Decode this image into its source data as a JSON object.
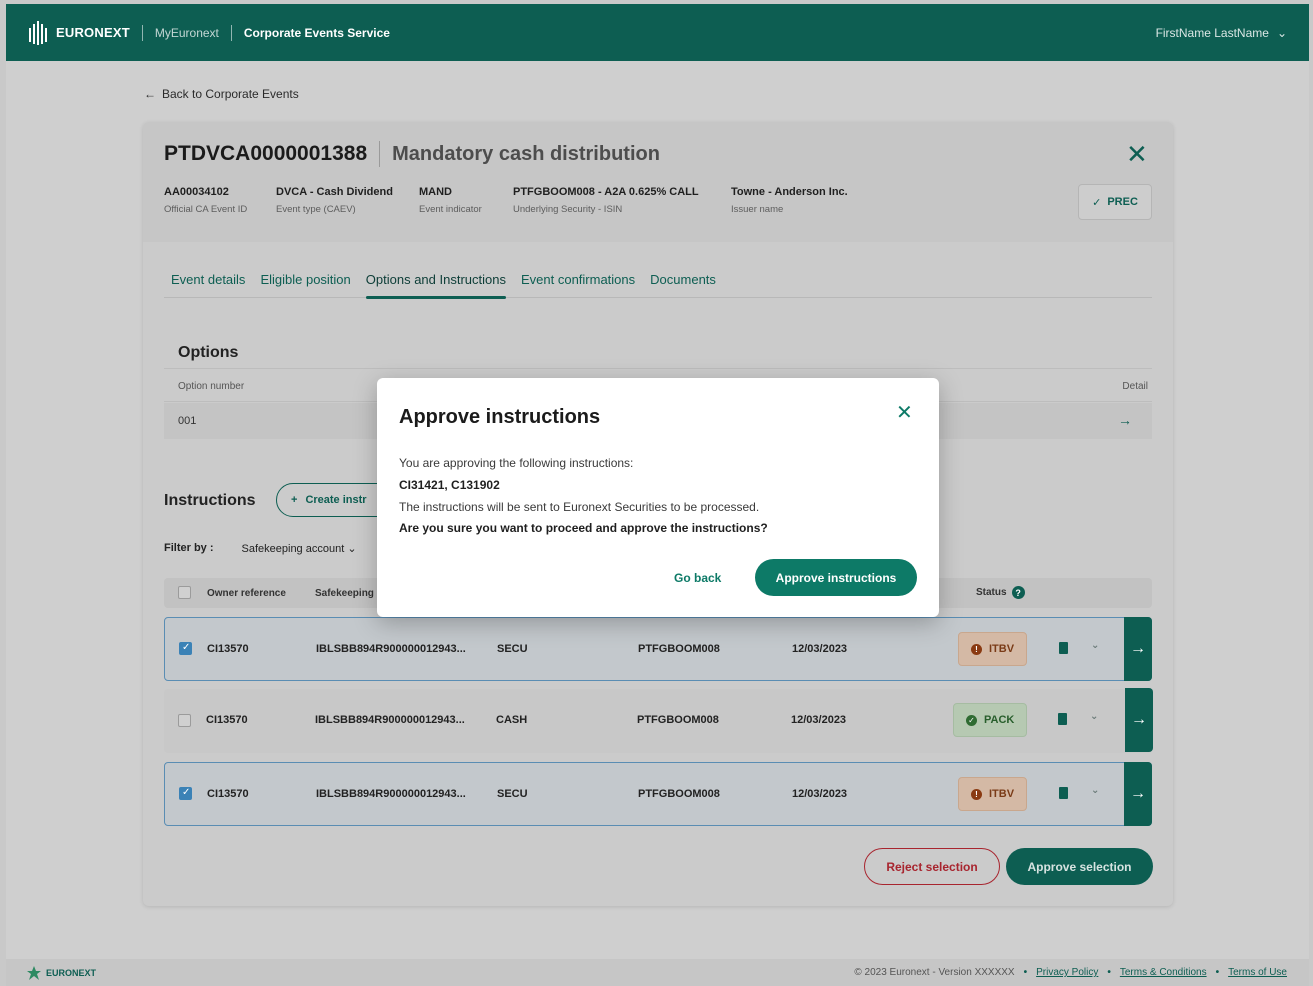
{
  "header": {
    "brand": "EURONEXT",
    "nav_link": "MyEuronext",
    "service": "Corporate Events Service",
    "user_name": "FirstName LastName"
  },
  "back_link": "Back to Corporate Events",
  "event": {
    "id": "PTDVCA0000001388",
    "name": "Mandatory cash distribution",
    "meta": [
      {
        "value": "AA00034102",
        "label": "Official CA Event ID"
      },
      {
        "value": "DVCA - Cash Dividend",
        "label": "Event type (CAEV)"
      },
      {
        "value": "MAND",
        "label": "Event indicator"
      },
      {
        "value": "PTFGBOOM008 - A2A 0.625% CALL",
        "label": "Underlying Security - ISIN"
      },
      {
        "value": "Towne - Anderson Inc.",
        "label": "Issuer name"
      }
    ],
    "status_button": "PREC"
  },
  "tabs": [
    {
      "label": "Event details"
    },
    {
      "label": "Eligible position"
    },
    {
      "label": "Options and Instructions"
    },
    {
      "label": "Event confirmations"
    },
    {
      "label": "Documents"
    }
  ],
  "options": {
    "title": "Options",
    "col_option_number": "Option number",
    "col_detail": "Detail",
    "row_option_number": "001"
  },
  "instructions": {
    "title": "Instructions",
    "create_button": "Create instr",
    "filter_label": "Filter by :",
    "filter_value": "Safekeeping account",
    "columns": {
      "owner": "Owner reference",
      "safekeeping": "Safekeeping",
      "status": "Status"
    },
    "rows": [
      {
        "owner": "CI13570",
        "account": "IBLSBB894R900000012943...",
        "type": "SECU",
        "isin": "PTFGBOOM008",
        "date": "12/03/2023",
        "status": "ITBV",
        "selected": true
      },
      {
        "owner": "CI13570",
        "account": "IBLSBB894R900000012943...",
        "type": "CASH",
        "isin": "PTFGBOOM008",
        "date": "12/03/2023",
        "status": "PACK",
        "selected": false
      },
      {
        "owner": "CI13570",
        "account": "IBLSBB894R900000012943...",
        "type": "SECU",
        "isin": "PTFGBOOM008",
        "date": "12/03/2023",
        "status": "ITBV",
        "selected": true
      }
    ],
    "reject_button": "Reject selection",
    "approve_button": "Approve selection"
  },
  "modal": {
    "title": "Approve instructions",
    "line1": "You are approving the following instructions:",
    "ids": "CI31421, C131902",
    "line3": "The instructions will be sent to Euronext Securities to be processed.",
    "question": "Are you sure you want to proceed and approve the instructions?",
    "go_back": "Go back",
    "approve": "Approve instructions"
  },
  "footer": {
    "brand": "EURONEXT",
    "copyright": "© 2023 Euronext - Version XXXXXX",
    "links": [
      "Privacy Policy",
      "Terms & Conditions",
      "Terms of Use"
    ]
  },
  "colors": {
    "brand_green": "#0d5e52",
    "reject_red": "#a8252f",
    "itbv": "#8a3a12",
    "pack": "#2f6b32"
  }
}
